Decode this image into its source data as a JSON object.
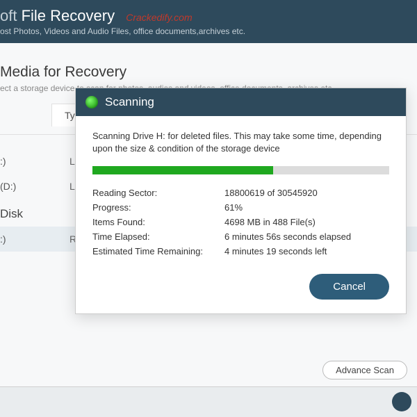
{
  "header": {
    "title_soft": "oft",
    "title_main": "File Recovery",
    "watermark": "Crackedify.com",
    "subtitle": "ost Photos, Videos and Audio Files, office documents,archives etc."
  },
  "page": {
    "heading": "Media for Recovery",
    "sub": "ect a storage device to scan for photos, audios and videos, office documents, archives etc."
  },
  "table": {
    "type_header": "Type"
  },
  "drives": {
    "row0": {
      "name": ":)",
      "type": "Local D"
    },
    "row1": {
      "name": "(D:)",
      "type": "Local D"
    },
    "section": "Disk",
    "row2": {
      "name": ":)",
      "type": "Remov"
    }
  },
  "modal": {
    "title": "Scanning",
    "message": "Scanning Drive H: for deleted files. This may take some time, depending upon the size & condition of the storage device",
    "progress_percent": 61,
    "stats": {
      "sector_label": "Reading Sector:",
      "sector_val": "18800619 of 30545920",
      "prog_label": "Progress:",
      "prog_val": "61%",
      "items_label": "Items Found:",
      "items_val": "4698 MB in 488 File(s)",
      "elapsed_label": "Time Elapsed:",
      "elapsed_val": "6 minutes 56s seconds elapsed",
      "remain_label": "Estimated Time Remaining:",
      "remain_val": "4 minutes 19 seconds left"
    },
    "cancel": "Cancel"
  },
  "advance_scan": "Advance Scan"
}
